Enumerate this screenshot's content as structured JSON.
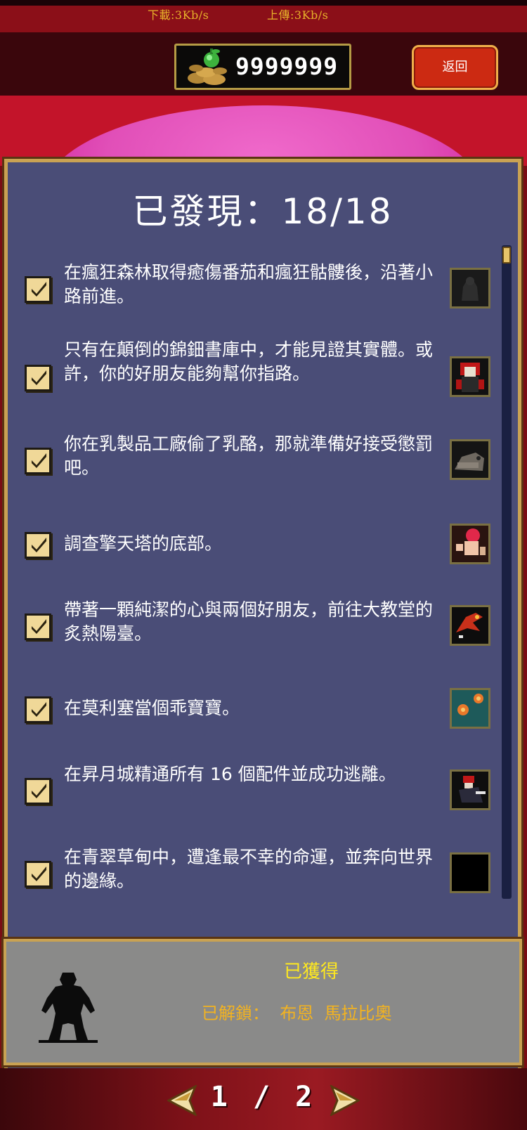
{
  "status": {
    "download": "下載:3Kb/s",
    "upload": "上傳:3Kb/s"
  },
  "header": {
    "coins": "9999999",
    "back_label": "返回"
  },
  "panel": {
    "title": "已發現：18/18"
  },
  "quests": [
    {
      "text": "在瘋狂森林取得癒傷番茄和瘋狂骷髏後，沿著小路前進。",
      "checked": true,
      "portrait": "dark-ape"
    },
    {
      "text": "只有在顛倒的錦鈿書庫中，才能見證其實體。或許，你的好朋友能夠幫你指路。",
      "checked": true,
      "portrait": "red-haired-figure"
    },
    {
      "text": "你在乳製品工廠偷了乳酪，那就準備好接受懲罰吧。",
      "checked": true,
      "portrait": "grey-rat"
    },
    {
      "text": "調查擎天塔的底部。",
      "checked": true,
      "portrait": "red-hair-warrior"
    },
    {
      "text": "帶著一顆純潔的心與兩個好朋友，前往大教堂的炙熱陽臺。",
      "checked": true,
      "portrait": "red-bird"
    },
    {
      "text": "在莫利塞當個乖寶寶。",
      "checked": true,
      "portrait": "orange-orbs"
    },
    {
      "text": "在昇月城精通所有 16 個配件並成功逃離。",
      "checked": true,
      "portrait": "dark-ninja"
    },
    {
      "text": "在青翠草甸中，遭逢最不幸的命運，並奔向世界的邊緣。",
      "checked": true,
      "portrait": "black-empty"
    }
  ],
  "detail": {
    "status": "已獲得",
    "unlock_text": "已解鎖：  布恩  馬拉比奧"
  },
  "pager": {
    "text": "1 / 2"
  },
  "colors": {
    "panel_bg": "#4a4d77",
    "gold_border": "#c9a253",
    "detail_bg": "#8a8a89",
    "acquired_yellow": "#ffe91e",
    "unlock_orange": "#f3b320",
    "back_button_red": "#cc2a12"
  }
}
